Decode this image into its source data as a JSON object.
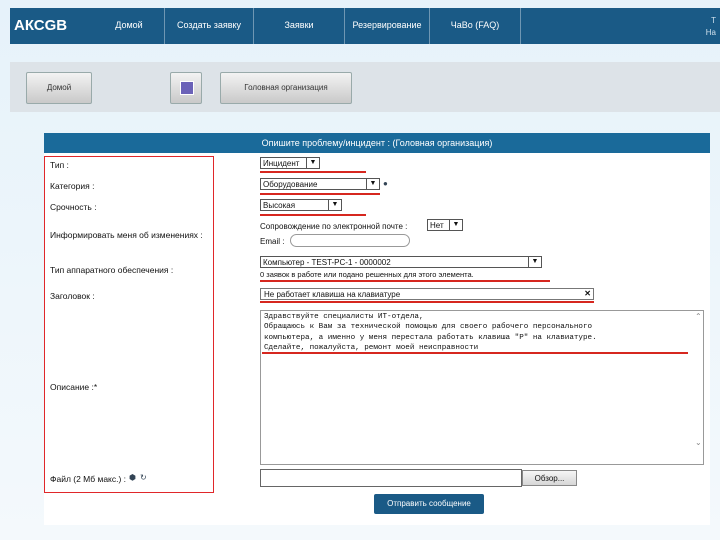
{
  "app": {
    "logo": "АКСGB"
  },
  "nav": {
    "items": [
      "Домой",
      "Создать заявку",
      "Заявки",
      "Резервирование",
      "ЧаВо (FAQ)"
    ],
    "right_line1": "Т",
    "right_line2": "На"
  },
  "toolbar": {
    "home_label": "Домой",
    "org_label": "Головная организация"
  },
  "form": {
    "header": "Опишите проблему/инцидент : (Головная организация)",
    "labels": {
      "type": "Тип :",
      "category": "Категория :",
      "urgency": "Срочность :",
      "inform": "Информировать меня об изменениях :",
      "hardware": "Тип аппаратного обеспечения :",
      "title": "Заголовок :",
      "description": "Описание :*",
      "file": "Файл (2 Мб макс.) :"
    },
    "type_value": "Инцидент",
    "category_value": "Оборудование",
    "urgency_value": "Высокая",
    "email_follow_label": "Сопровождение по электронной почте :",
    "email_follow_value": "Нет",
    "email_label": "Email :",
    "email_value": "",
    "hardware_value": "Компьютер - TEST-PC-1 - 0000002",
    "hardware_note": "0 заявок в работе или подано решенных для этого элемента.",
    "title_value": "Не работает клавиша на клавиатуре",
    "description_text": "Здравствуйте специалисты ИТ-отдела,\nОбращаюсь к Вам за технической помощью для своего рабочего персонального\nкомпьютера, а именно у меня перестала работать клавиша \"P\" на клавиатуре.\nСделайте, пожалуйста, ремонт моей неисправности",
    "file_button": "Обзор...",
    "submit": "Отправить сообщение"
  },
  "colors": {
    "nav": "#1a5a86",
    "header": "#1a6a9a",
    "highlight": "#e0272a"
  },
  "icons": {
    "category_help": "info-icon",
    "file_icons": [
      "attach-icon",
      "refresh-icon"
    ],
    "title_clear": "close-icon"
  }
}
